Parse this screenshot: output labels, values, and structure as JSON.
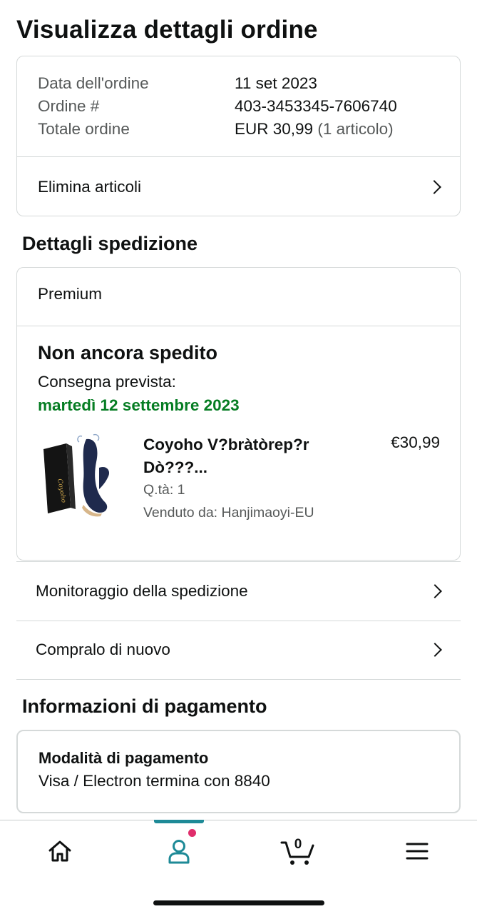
{
  "page": {
    "title": "Visualizza dettagli ordine"
  },
  "order_summary": {
    "rows": [
      {
        "label": "Data dell'ordine",
        "value": "11 set 2023"
      },
      {
        "label": "Ordine #",
        "value": "403-3453345-7606740"
      },
      {
        "label": "Totale ordine",
        "value": "EUR 30,99",
        "note": "(1 articolo)"
      }
    ],
    "action_label": "Elimina articoli"
  },
  "shipping": {
    "heading": "Dettagli spedizione",
    "service": "Premium",
    "status": "Non ancora spedito",
    "eta_label": "Consegna prevista:",
    "eta_date": "martedì 12 settembre 2023",
    "eta_color": "#067d23",
    "item": {
      "title_line1": "Coyoho V?bràtòrep?r",
      "title_line2": "Dò???...",
      "price": "€30,99",
      "quantity": "Q.tà: 1",
      "seller": "Venduto da: Hanjimaoyi-EU",
      "box_brand": "Coyoho"
    },
    "actions": [
      {
        "label": "Monitoraggio della spedizione"
      },
      {
        "label": "Compralo di nuovo"
      }
    ]
  },
  "payment": {
    "heading": "Informazioni di pagamento",
    "method_title": "Modalità di pagamento",
    "method_value": "Visa / Electron  termina con 8840"
  },
  "tabbar": {
    "accent_color": "#1e8a97",
    "notification_color": "#e02d6b",
    "cart_count": "0",
    "tabs": [
      {
        "name": "home",
        "icon": "home-icon"
      },
      {
        "name": "account",
        "icon": "person-icon",
        "active": true
      },
      {
        "name": "cart",
        "icon": "cart-icon"
      },
      {
        "name": "menu",
        "icon": "menu-icon"
      }
    ]
  }
}
